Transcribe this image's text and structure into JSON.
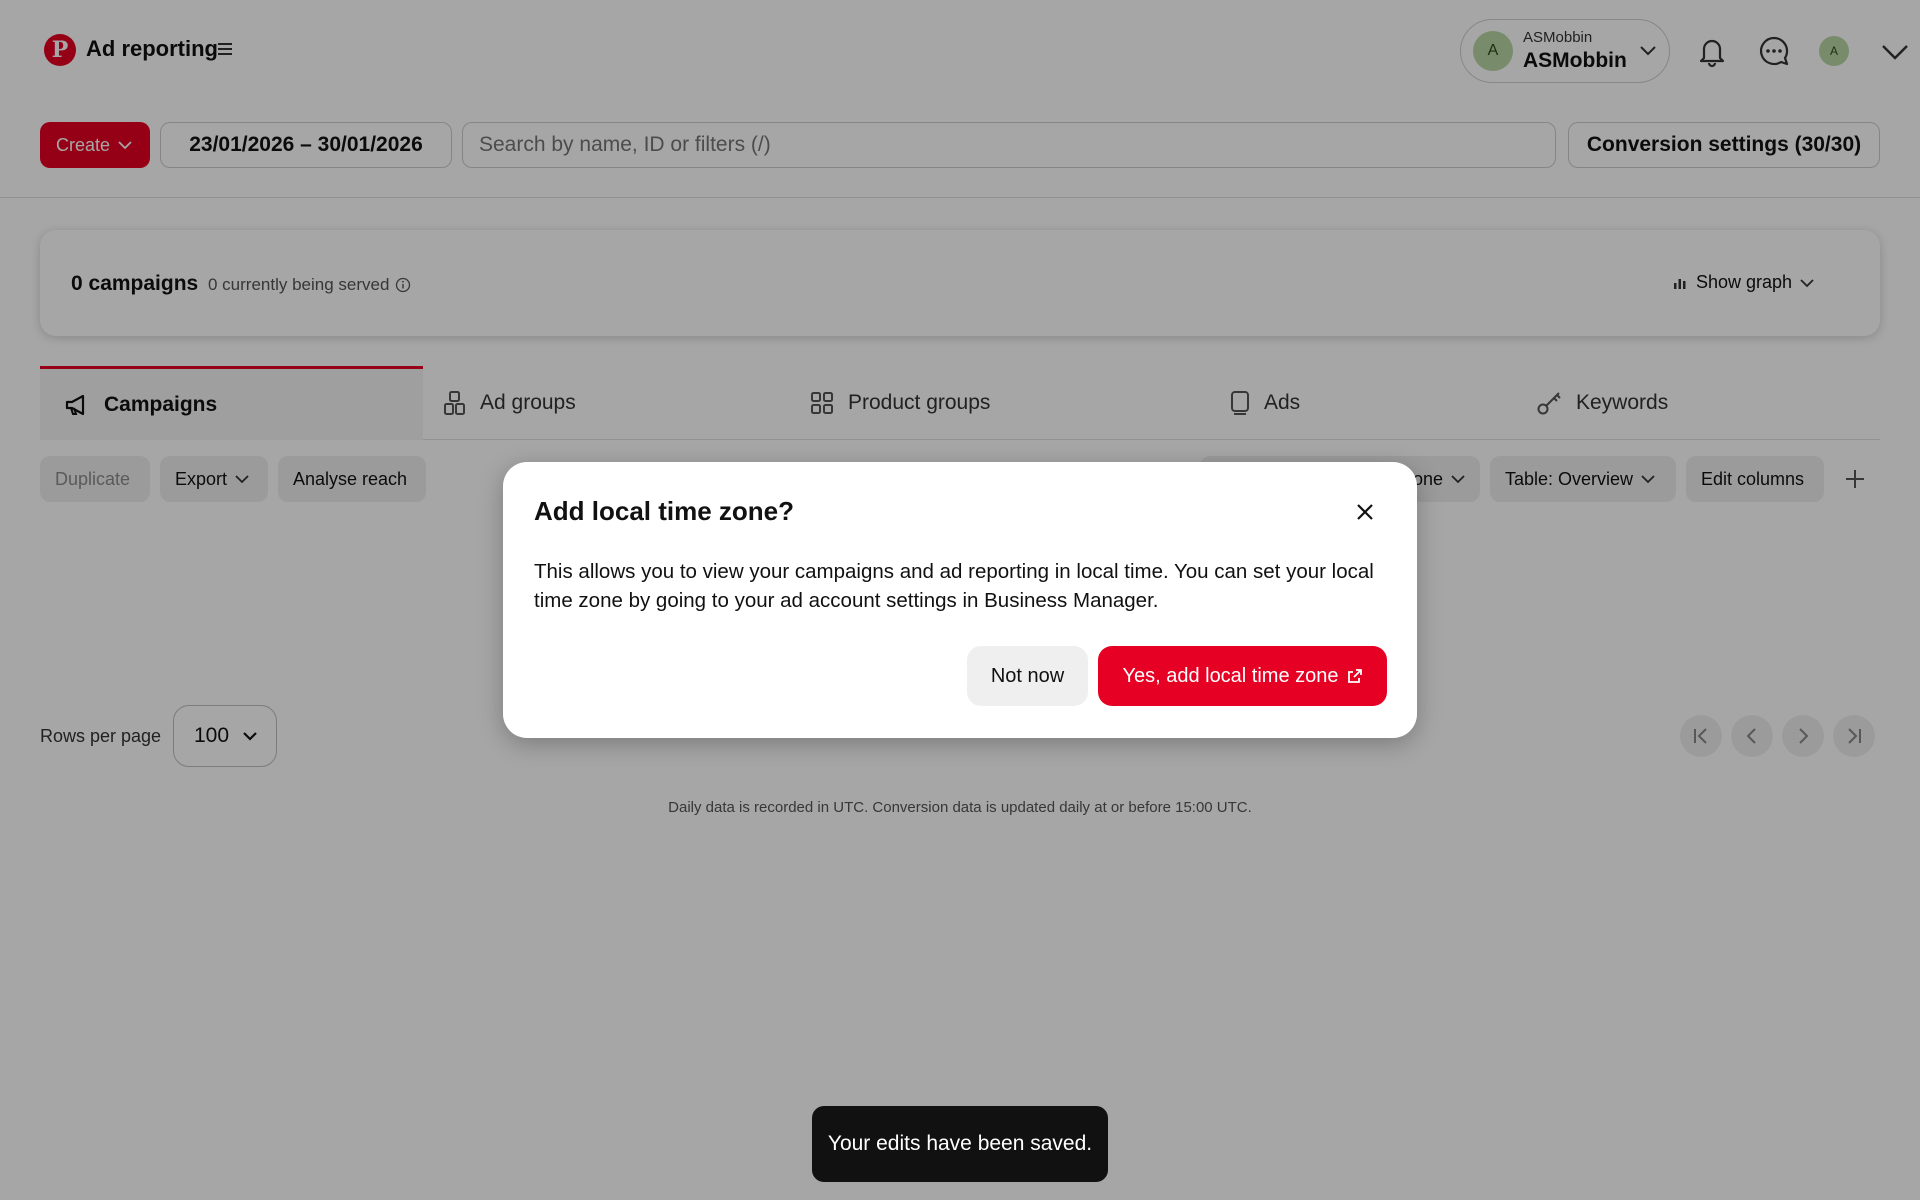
{
  "header": {
    "app_title": "Ad reporting",
    "account": {
      "small_name": "ASMobbin",
      "name": "ASMobbin",
      "avatar_initial": "A"
    },
    "profile_initial": "A"
  },
  "toolbar": {
    "create_label": "Create",
    "date_range": "23/01/2026 – 30/01/2026",
    "search_placeholder": "Search by name, ID or filters (/)",
    "conversion_settings": "Conversion settings (30/30)"
  },
  "summary": {
    "campaign_count": "0 campaigns",
    "served": "0 currently being served",
    "show_graph": "Show graph"
  },
  "tabs": [
    {
      "label": "Campaigns",
      "icon": "megaphone-icon",
      "active": true
    },
    {
      "label": "Ad groups",
      "icon": "ad-groups-icon"
    },
    {
      "label": "Product groups",
      "icon": "grid-icon"
    },
    {
      "label": "Ads",
      "icon": "phone-icon"
    },
    {
      "label": "Keywords",
      "icon": "key-icon"
    }
  ],
  "actions": {
    "duplicate": "Duplicate",
    "export": "Export",
    "analyse_reach": "Analyse reach",
    "partial_filter": "one",
    "table": "Table: Overview",
    "edit_columns": "Edit columns"
  },
  "pagination": {
    "rows_label": "Rows per page",
    "rows_value": "100"
  },
  "footnote": "Daily data is recorded in UTC. Conversion data is updated daily at or before 15:00 UTC.",
  "modal": {
    "title": "Add local time zone?",
    "body": "This allows you to view your campaigns and ad reporting in local time. You can set your local time zone by going to your ad account settings in Business Manager.",
    "secondary": "Not now",
    "primary": "Yes, add local time zone"
  },
  "toast": "Your edits have been saved.",
  "colors": {
    "brand": "#e60023",
    "overlay": "rgba(0,0,0,0.35)"
  }
}
